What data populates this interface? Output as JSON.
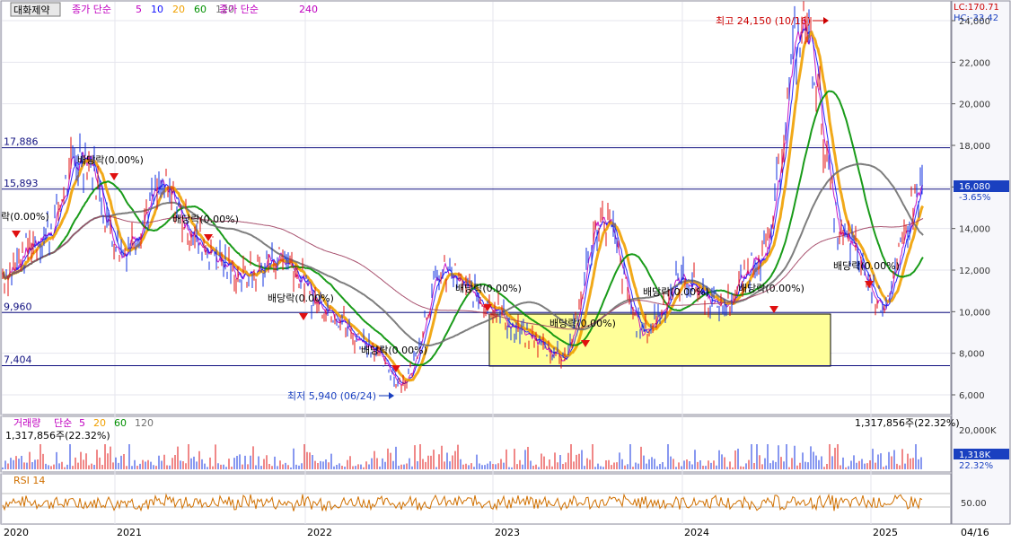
{
  "header": {
    "stock_name": "대화제약",
    "price_legend_prefix": "종가 단순",
    "ma_periods": [
      "5",
      "10",
      "20",
      "60",
      "120"
    ],
    "ma_colors": [
      "#c000c0",
      "#1010ff",
      "#f0a000",
      "#009000",
      "#707070"
    ],
    "extra_ma_label": "종가 단순",
    "extra_ma_period": "240",
    "lc_text": "LC:170.71",
    "hc_text": "HC:-33.42"
  },
  "volume_legend": {
    "label": "거래량",
    "prefix": "단순",
    "periods": [
      "5",
      "20",
      "60",
      "120"
    ],
    "colors": [
      "#c000c0",
      "#f0a000",
      "#009000",
      "#707070"
    ],
    "left_value": "1,317,856주(22.32%)",
    "right_value": "1,317,856주(22.32%)"
  },
  "rsi_legend": {
    "label": "RSI 14",
    "tick": "50.00"
  },
  "price_axis": {
    "ticks": [
      "24,000",
      "22,000",
      "20,000",
      "18,000",
      "16,000",
      "14,000",
      "12,000",
      "10,000",
      "8,000",
      "6,000"
    ],
    "current_price": "16,080",
    "current_change": "-3.65%"
  },
  "volume_axis": {
    "tick": "20,000K",
    "current": "1,318K",
    "current_pct": "22.32%"
  },
  "x_axis": {
    "labels": [
      "2020",
      "2021",
      "2022",
      "2023",
      "2024",
      "2025"
    ],
    "right_label": "04/16"
  },
  "horizontal_levels": [
    {
      "label": "17,886",
      "value": 17886
    },
    {
      "label": "15,893",
      "value": 15893
    },
    {
      "label": "9,960",
      "value": 9960
    },
    {
      "label": "7,404",
      "value": 7404
    }
  ],
  "annotations": {
    "high": "최고 24,150 (10/16)",
    "low": "최저 5,940 (06/24)",
    "dividends": [
      "락(0.00%)",
      "배당락(0.00%)",
      "배당락(0.00%)",
      "배당락(0.00%)",
      "배당락(0.00%)",
      "배당락(0.00%)",
      "배당락(0.00%)",
      "배당락(0.00%)",
      "배당락(0.00%)",
      "배당락(0.00%)"
    ]
  },
  "chart_data": {
    "type": "line",
    "title": "대화제약",
    "x": [
      "2020-01",
      "2020-04",
      "2020-07",
      "2020-10",
      "2021-01",
      "2021-04",
      "2021-07",
      "2021-10",
      "2022-01",
      "2022-04",
      "2022-06",
      "2022-09",
      "2022-12",
      "2023-03",
      "2023-06",
      "2023-09",
      "2023-12",
      "2024-03",
      "2024-06",
      "2024-09",
      "2024-10",
      "2024-12",
      "2025-02",
      "2025-04"
    ],
    "series": [
      {
        "name": "종가",
        "values": [
          11800,
          13600,
          17500,
          13000,
          15800,
          13200,
          11700,
          12600,
          10300,
          8600,
          6600,
          11900,
          10600,
          8900,
          7900,
          14500,
          9100,
          11500,
          10300,
          12800,
          23800,
          13600,
          10500,
          16080
        ]
      }
    ],
    "ylim": [
      5000,
      24800
    ],
    "high": {
      "value": 24150,
      "date": "10/16"
    },
    "low": {
      "value": 5940,
      "date": "06/24"
    },
    "horizontal_lines": [
      17886,
      15893,
      9960,
      7404
    ]
  }
}
